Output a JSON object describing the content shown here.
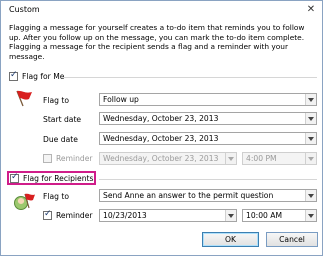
{
  "window": {
    "title": "Custom",
    "close_glyph": "✕"
  },
  "description": "Flagging a message for yourself creates a to-do item that reminds you to follow up. After you follow up on the message, you can mark the to-do item complete. Flagging a message for the recipient sends a flag and a reminder with your message.",
  "flag_for_me": {
    "label": "Flag for Me",
    "checked": true,
    "icon": "red-flag-icon",
    "flag_to_label": "Flag to",
    "flag_to_value": "Follow up",
    "start_date_label": "Start date",
    "start_date_value": "Wednesday, October 23, 2013",
    "due_date_label": "Due date",
    "due_date_value": "Wednesday, October 23, 2013",
    "reminder_label": "Reminder",
    "reminder_checked": false,
    "reminder_date_value": "Wednesday, October 23, 2013",
    "reminder_time_value": "4:00 PM"
  },
  "flag_for_recipients": {
    "label": "Flag for Recipients",
    "checked": true,
    "icon": "recipient-flag-icon",
    "flag_to_label": "Flag to",
    "flag_to_value": "Send Anne an answer to the permit question",
    "reminder_label": "Reminder",
    "reminder_checked": true,
    "reminder_date_value": "10/23/2013",
    "reminder_time_value": "10:00 AM"
  },
  "buttons": {
    "ok": "OK",
    "cancel": "Cancel"
  },
  "colors": {
    "highlight": "#d01d8a",
    "accent": "#3c7fb1"
  }
}
